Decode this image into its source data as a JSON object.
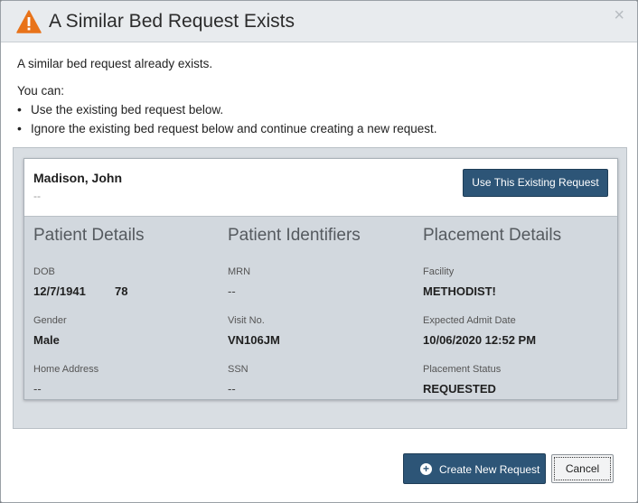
{
  "dialog": {
    "title": "A Similar Bed Request Exists",
    "close_glyph": "×",
    "message": "A similar bed request already exists.",
    "you_can": "You can:",
    "options": [
      "Use the existing bed request below.",
      "Ignore the existing bed request below and continue creating a new request."
    ]
  },
  "request": {
    "patient_name": "Madison, John",
    "patient_sub": "--",
    "use_button": "Use This Existing Request",
    "patient_details": {
      "heading": "Patient Details",
      "dob_label": "DOB",
      "dob": "12/7/1941",
      "age": "78",
      "gender_label": "Gender",
      "gender": "Male",
      "address_label": "Home Address",
      "address": "--"
    },
    "patient_identifiers": {
      "heading": "Patient Identifiers",
      "mrn_label": "MRN",
      "mrn": "--",
      "visit_label": "Visit No.",
      "visit": "VN106JM",
      "ssn_label": "SSN",
      "ssn": "--"
    },
    "placement_details": {
      "heading": "Placement Details",
      "facility_label": "Facility",
      "facility": "METHODIST!",
      "admit_label": "Expected Admit Date",
      "admit": "10/06/2020 12:52 PM",
      "status_label": "Placement Status",
      "status": "REQUESTED"
    }
  },
  "footer": {
    "create_button": "Create New Request",
    "create_icon": "plus-circle-icon",
    "cancel_button": "Cancel"
  },
  "colors": {
    "primary": "#2d5577",
    "warning": "#e8731a",
    "panel": "#d9dee3"
  }
}
